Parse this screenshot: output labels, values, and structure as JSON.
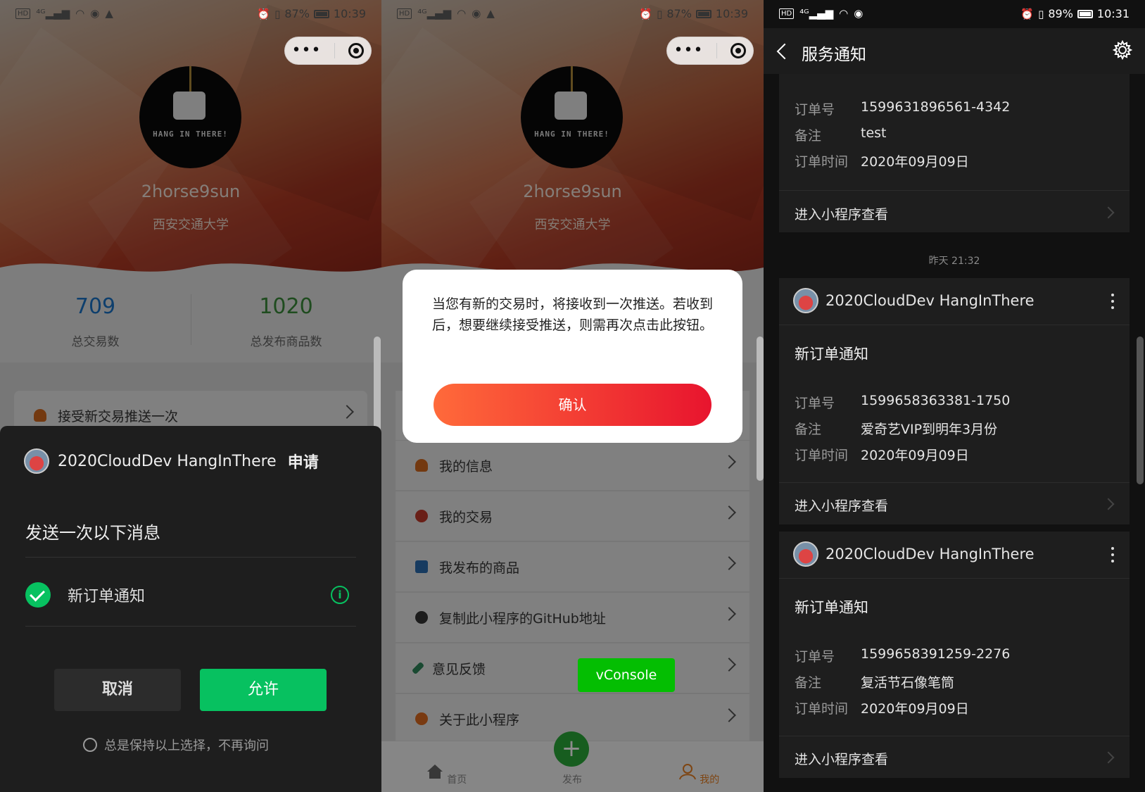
{
  "status_p1": {
    "left_icons": [
      "HD",
      "4G",
      "signal",
      "wifi",
      "eye",
      "notification"
    ],
    "battery": "87%",
    "time": "10:39"
  },
  "status_p3": {
    "battery": "89%",
    "time": "10:31"
  },
  "profile": {
    "avatar_text": "HANG IN THERE!",
    "username": "2horse9sun",
    "school": "西安交通大学",
    "stats": [
      {
        "value": "709",
        "label": "总交易数",
        "color": "#1a73c6"
      },
      {
        "value": "1020",
        "label": "总发布商品数",
        "color": "#3a8a3a"
      }
    ]
  },
  "menu": {
    "push_once": "接受新交易推送一次",
    "items": [
      {
        "label": "我的信息",
        "icon_color": "#d2691e"
      },
      {
        "label": "我的交易",
        "icon_color": "#c0392b"
      },
      {
        "label": "我发布的商品",
        "icon_color": "#2b6cb0"
      },
      {
        "label": "复制此小程序的GitHub地址",
        "icon_color": "#333333"
      },
      {
        "label": "意见反馈",
        "icon_color": "#2f855a"
      },
      {
        "label": "关于此小程序",
        "icon_color": "#dd6b20"
      }
    ]
  },
  "permission_sheet": {
    "app_name": "2020CloudDev HangInThere",
    "apply": "申请",
    "message": "发送一次以下消息",
    "item": "新订单通知",
    "cancel": "取消",
    "allow": "允许",
    "keep": "总是保持以上选择，不再询问"
  },
  "modal": {
    "text": "当您有新的交易时，将接收到一次推送。若收到后，想要继续接受推送，则需再次点击此按钮。",
    "confirm": "确认"
  },
  "vconsole": "vConsole",
  "tabbar": {
    "home": "首页",
    "publish": "发布",
    "mine": "我的"
  },
  "service": {
    "title": "服务通知",
    "labels": {
      "order_no": "订单号",
      "note": "备注",
      "order_time": "订单时间",
      "enter": "进入小程序查看"
    },
    "timestamp": "昨天 21:32",
    "app_name": "2020CloudDev HangInThere",
    "notice_title": "新订单通知",
    "cards": [
      {
        "order_no": "1599631896561-4342",
        "note": "test",
        "order_time": "2020年09月09日"
      },
      {
        "order_no": "1599658363381-1750",
        "note": "爱奇艺VIP到明年3月份",
        "order_time": "2020年09月09日"
      },
      {
        "order_no": "1599658391259-2276",
        "note": "复活节石像笔筒",
        "order_time": "2020年09月09日"
      }
    ]
  }
}
